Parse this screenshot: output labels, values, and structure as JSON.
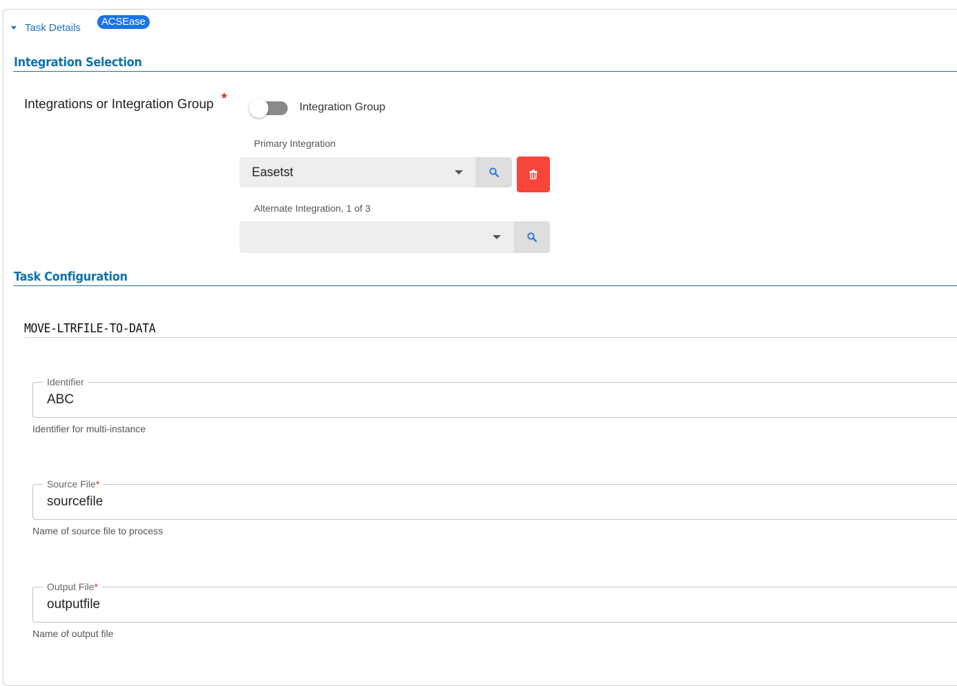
{
  "task_details": {
    "label": "Task Details",
    "badge": "ACSEase"
  },
  "integration_selection": {
    "title": "Integration Selection",
    "field_label": "Integrations or Integration Group",
    "required_mark": "*",
    "toggle_label": "Integration Group",
    "toggle_on": false,
    "primary": {
      "label": "Primary Integration",
      "value": "Easetst"
    },
    "alternate": {
      "label": "Alternate Integration, 1 of 3",
      "value": ""
    }
  },
  "task_configuration": {
    "title": "Task Configuration",
    "task_name": "MOVE-LTRFILE-TO-DATA",
    "fields": [
      {
        "label": "Identifier",
        "required": false,
        "value": "ABC",
        "helper": "Identifier for multi-instance"
      },
      {
        "label": "Source File",
        "required": true,
        "value": "sourcefile",
        "helper": "Name of source file to process"
      },
      {
        "label": "Output File",
        "required": true,
        "value": "outputfile",
        "helper": "Name of output file"
      }
    ]
  },
  "colors": {
    "accent": "#1173a8",
    "link": "#1e73be",
    "badge": "#1a73e8",
    "danger": "#f6453a",
    "required": "#e0201a"
  },
  "icons": {
    "collapse": "caret-down-icon",
    "search": "search-icon",
    "delete": "trash-icon",
    "dropdown": "chevron-down-icon"
  }
}
